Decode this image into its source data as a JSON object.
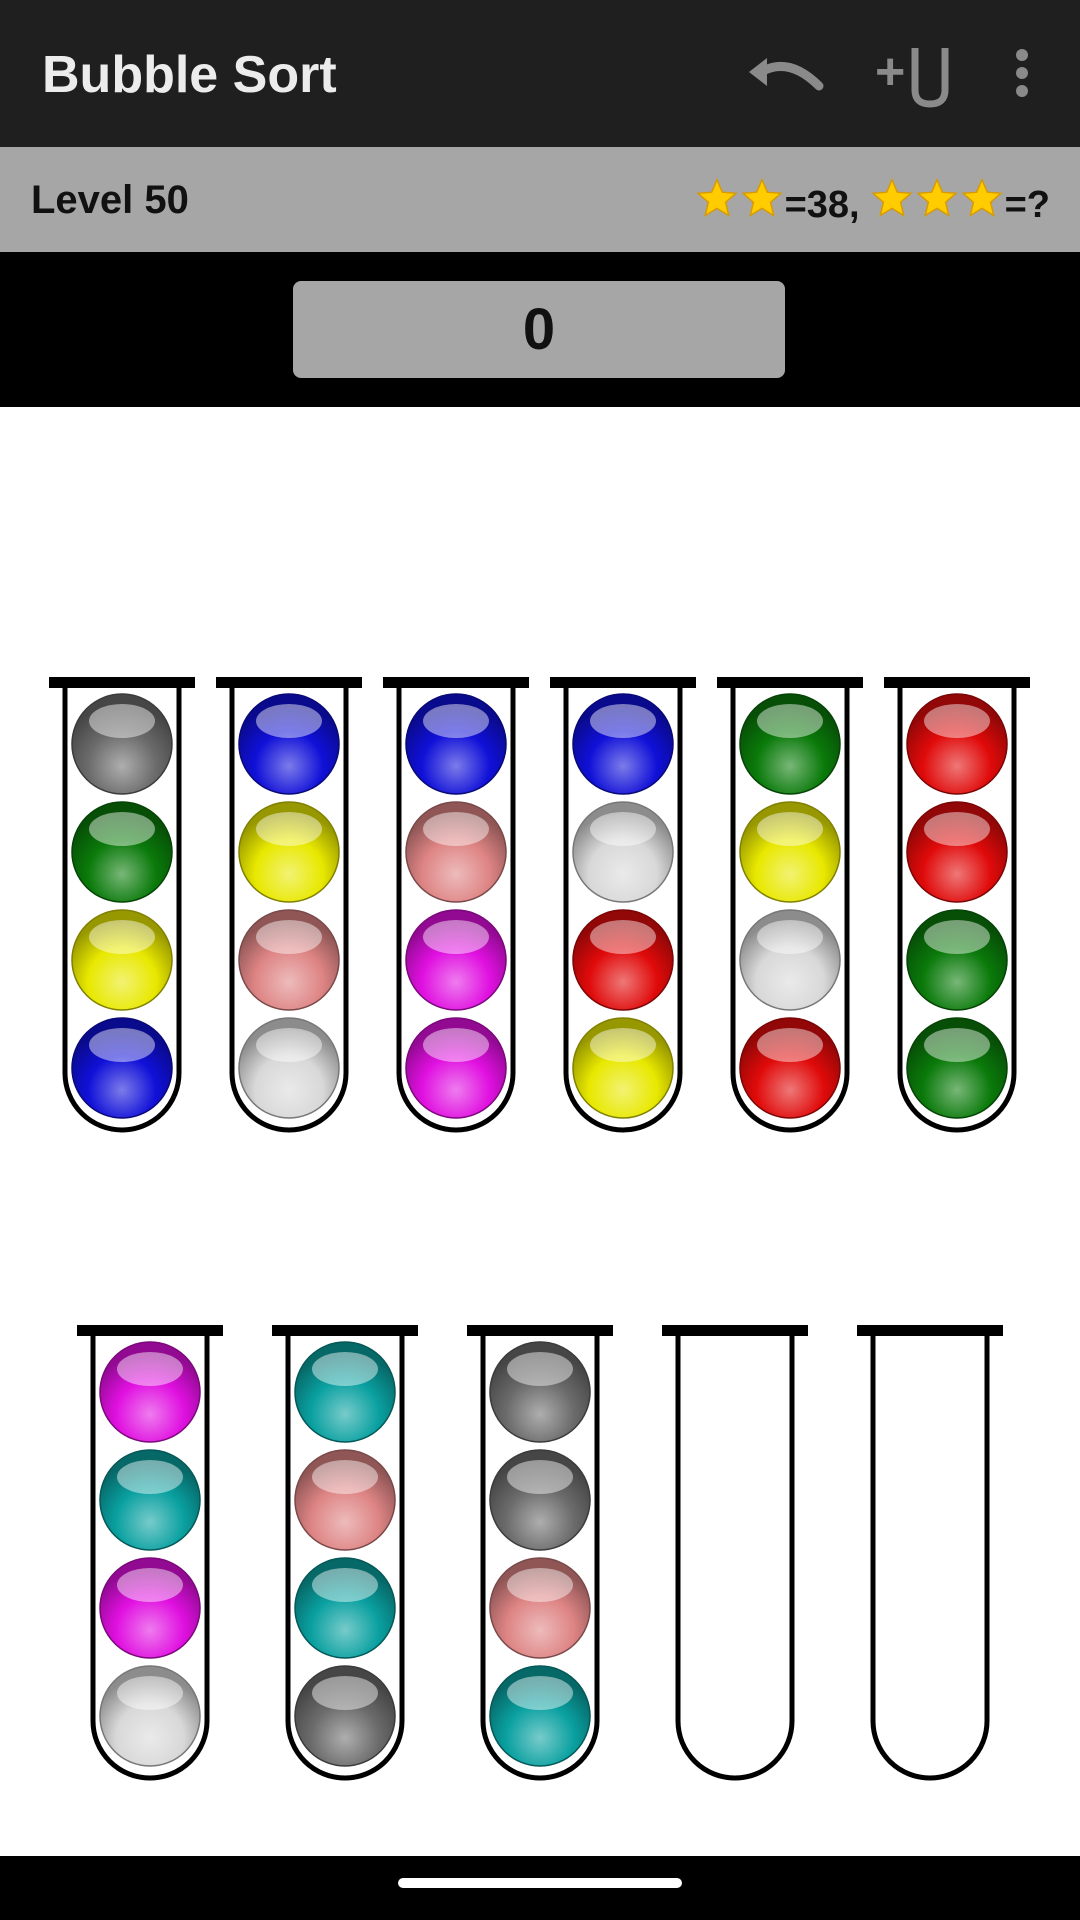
{
  "app": {
    "title": "Bubble Sort",
    "toolbar": [
      {
        "name": "undo-icon"
      },
      {
        "name": "add-tube-icon",
        "label": "+"
      },
      {
        "name": "more-vert-icon"
      }
    ]
  },
  "level": {
    "label": "Level 50",
    "two_star_text": "=38,",
    "three_star_text": "=?",
    "two_star_count": 2,
    "three_star_count": 3
  },
  "moves": {
    "value": "0"
  },
  "colors": {
    "gray": "#6b6b6b",
    "green": "#0a7a0a",
    "yellow": "#e8e800",
    "blue": "#1010d8",
    "pink": "#de8484",
    "silver": "#d8d8d8",
    "magenta": "#e010e0",
    "red": "#e00a0a",
    "teal": "#0aa0a0",
    "star": "#ffcc00"
  },
  "tubes": {
    "row1": [
      [
        "gray",
        "green",
        "yellow",
        "blue"
      ],
      [
        "blue",
        "yellow",
        "pink",
        "silver"
      ],
      [
        "blue",
        "pink",
        "magenta",
        "magenta"
      ],
      [
        "blue",
        "silver",
        "red",
        "yellow"
      ],
      [
        "green",
        "yellow",
        "silver",
        "red"
      ],
      [
        "red",
        "red",
        "green",
        "green"
      ]
    ],
    "row2": [
      [
        "magenta",
        "teal",
        "magenta",
        "silver"
      ],
      [
        "teal",
        "pink",
        "teal",
        "gray"
      ],
      [
        "gray",
        "gray",
        "pink",
        "teal"
      ],
      [],
      []
    ]
  }
}
